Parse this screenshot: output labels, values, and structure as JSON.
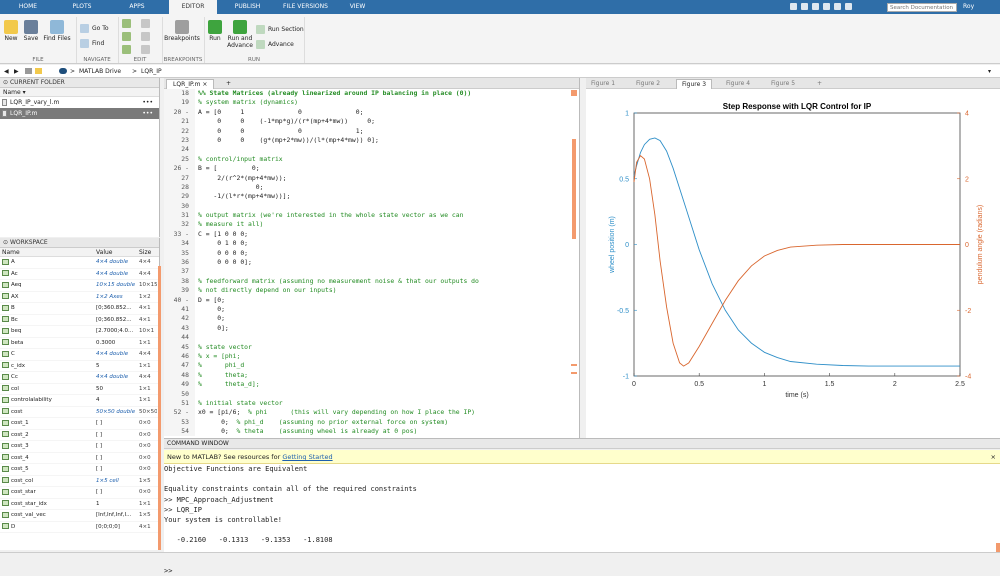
{
  "tabstrip": {
    "tabs": [
      "HOME",
      "PLOTS",
      "APPS",
      "EDITOR",
      "PUBLISH",
      "FILE VERSIONS",
      "VIEW"
    ],
    "active": "EDITOR",
    "search_placeholder": "Search Documentation",
    "user": "Roy"
  },
  "ribbon": {
    "file": {
      "new": "New",
      "save": "Save",
      "find_files": "Find Files",
      "group": "FILE"
    },
    "navigate": {
      "goto": "Go To",
      "find": "Find",
      "group": "NAVIGATE"
    },
    "edit": {
      "group": "EDIT"
    },
    "breakpoints": {
      "label": "Breakpoints",
      "group": "BREAKPOINTS"
    },
    "run": {
      "run": "Run",
      "run_advance": "Run and",
      "run_advance2": "Advance",
      "run_section": "Run Section",
      "advance": "Advance",
      "group": "RUN"
    }
  },
  "address": {
    "sep": ">",
    "path": [
      "MATLAB Drive",
      "LQR_IP"
    ]
  },
  "current_folder": {
    "title": "CURRENT FOLDER",
    "col": "Name",
    "files": [
      {
        "name": "LQR_IP_vary_l.m",
        "selected": false
      },
      {
        "name": "LQR_IP.m",
        "selected": true
      }
    ]
  },
  "workspace": {
    "title": "WORKSPACE",
    "cols": [
      "Name",
      "Value",
      "Size"
    ],
    "rows": [
      {
        "n": "A",
        "v": "4×4 double",
        "s": "4×4",
        "i": true
      },
      {
        "n": "Ac",
        "v": "4×4 double",
        "s": "4×4",
        "i": true
      },
      {
        "n": "Aeq",
        "v": "10×15 double",
        "s": "10×15",
        "i": true
      },
      {
        "n": "AX",
        "v": "1×2 Axes",
        "s": "1×2",
        "i": true
      },
      {
        "n": "B",
        "v": "[0;360.852...",
        "s": "4×1",
        "i": false
      },
      {
        "n": "Bc",
        "v": "[0;360.852...",
        "s": "4×1",
        "i": false
      },
      {
        "n": "beq",
        "v": "[2.7000;4.0...",
        "s": "10×1",
        "i": false
      },
      {
        "n": "beta",
        "v": "0.3000",
        "s": "1×1",
        "i": false
      },
      {
        "n": "C",
        "v": "4×4 double",
        "s": "4×4",
        "i": true
      },
      {
        "n": "c_idx",
        "v": "5",
        "s": "1×1",
        "i": false
      },
      {
        "n": "Cc",
        "v": "4×4 double",
        "s": "4×4",
        "i": true
      },
      {
        "n": "col",
        "v": "50",
        "s": "1×1",
        "i": false
      },
      {
        "n": "controlalability",
        "v": "4",
        "s": "1×1",
        "i": false
      },
      {
        "n": "cost",
        "v": "50×50 double",
        "s": "50×50",
        "i": true
      },
      {
        "n": "cost_1",
        "v": "[ ]",
        "s": "0×0",
        "i": false
      },
      {
        "n": "cost_2",
        "v": "[ ]",
        "s": "0×0",
        "i": false
      },
      {
        "n": "cost_3",
        "v": "[ ]",
        "s": "0×0",
        "i": false
      },
      {
        "n": "cost_4",
        "v": "[ ]",
        "s": "0×0",
        "i": false
      },
      {
        "n": "cost_5",
        "v": "[ ]",
        "s": "0×0",
        "i": false
      },
      {
        "n": "cost_col",
        "v": "1×5 cell",
        "s": "1×5",
        "i": true
      },
      {
        "n": "cost_star",
        "v": "[ ]",
        "s": "0×0",
        "i": false
      },
      {
        "n": "cost_star_idx",
        "v": "1",
        "s": "1×1",
        "i": false
      },
      {
        "n": "cost_val_vec",
        "v": "[Inf,Inf,Inf,I...",
        "s": "1×5",
        "i": false
      },
      {
        "n": "D",
        "v": "[0;0;0;0]",
        "s": "4×1",
        "i": false
      }
    ]
  },
  "editor": {
    "tab": "LQR_IP.m",
    "lines": [
      {
        "n": "18",
        "t": "%% State Matrices (already linearized around IP balancing in place (0))",
        "c": "cb"
      },
      {
        "n": "19",
        "t": "% system matrix (dynamics)",
        "c": "cm"
      },
      {
        "n": "20 -",
        "t": "A = [0     1              0              0;",
        "c": ""
      },
      {
        "n": "21",
        "t": "     0     0    (-1*mp*g)/(r*(mp+4*mw))     0;",
        "c": ""
      },
      {
        "n": "22",
        "t": "     0     0              0              1;",
        "c": ""
      },
      {
        "n": "23",
        "t": "     0     0    (g*(mp+2*mw))/(l*(mp+4*mw)) 0];",
        "c": ""
      },
      {
        "n": "24",
        "t": "",
        "c": ""
      },
      {
        "n": "25",
        "t": "% control/input matrix",
        "c": "cm"
      },
      {
        "n": "26 -",
        "t": "B = [         0;",
        "c": ""
      },
      {
        "n": "27",
        "t": "     2/(r^2*(mp+4*mw));",
        "c": ""
      },
      {
        "n": "28",
        "t": "               0;",
        "c": ""
      },
      {
        "n": "29",
        "t": "    -1/(l*r*(mp+4*mw))];",
        "c": ""
      },
      {
        "n": "30",
        "t": "",
        "c": ""
      },
      {
        "n": "31",
        "t": "% output matrix (we're interested in the whole state vector as we can",
        "c": "cm"
      },
      {
        "n": "32",
        "t": "% measure it all)",
        "c": "cm"
      },
      {
        "n": "33 -",
        "t": "C = [1 0 0 0;",
        "c": ""
      },
      {
        "n": "34",
        "t": "     0 1 0 0;",
        "c": ""
      },
      {
        "n": "35",
        "t": "     0 0 0 0;",
        "c": ""
      },
      {
        "n": "36",
        "t": "     0 0 0 0];",
        "c": ""
      },
      {
        "n": "37",
        "t": "",
        "c": ""
      },
      {
        "n": "38",
        "t": "% feedforward matrix (assuming no measurement noise & that our outputs do",
        "c": "cm"
      },
      {
        "n": "39",
        "t": "% not directly depend on our inputs)",
        "c": "cm"
      },
      {
        "n": "40 -",
        "t": "D = [0;",
        "c": ""
      },
      {
        "n": "41",
        "t": "     0;",
        "c": ""
      },
      {
        "n": "42",
        "t": "     0;",
        "c": ""
      },
      {
        "n": "43",
        "t": "     0];",
        "c": ""
      },
      {
        "n": "44",
        "t": "",
        "c": ""
      },
      {
        "n": "45",
        "t": "% state vector",
        "c": "cm"
      },
      {
        "n": "46",
        "t": "% x = [phi;",
        "c": "cm"
      },
      {
        "n": "47",
        "t": "%      phi_d",
        "c": "cm"
      },
      {
        "n": "48",
        "t": "%      theta;",
        "c": "cm"
      },
      {
        "n": "49",
        "t": "%      theta_d];",
        "c": "cm"
      },
      {
        "n": "50",
        "t": "",
        "c": ""
      },
      {
        "n": "51",
        "t": "% initial state vector",
        "c": "cm"
      },
      {
        "n": "52 -",
        "t": "x0 = [pi/6;  % phi      (this will vary depending on how I place the IP)",
        "c": "mix"
      },
      {
        "n": "53",
        "t": "      0;  % phi_d    (assuming no prior external force on system)",
        "c": "mix"
      },
      {
        "n": "54",
        "t": "      0;  % theta    (assuming wheel is already at 0 pos)",
        "c": "mix"
      }
    ]
  },
  "figures": {
    "tabs": [
      "Figure 1",
      "Figure 2",
      "Figure 3",
      "Figure 4",
      "Figure 5"
    ],
    "active": "Figure 3"
  },
  "chart_data": {
    "type": "line",
    "title": "Step Response with LQR Control for IP",
    "xlabel": "time (s)",
    "ylabel_left": "wheel position (m)",
    "ylabel_right": "pendulum angle (radians)",
    "xlim": [
      0,
      2.5
    ],
    "ylim_left": [
      -1,
      1
    ],
    "ylim_right": [
      -4,
      4
    ],
    "xticks": [
      "0",
      "0.5",
      "1",
      "1.5",
      "2",
      "2.5"
    ],
    "yticks_left": [
      "1",
      "0.5",
      "0",
      "-0.5",
      "-1"
    ],
    "yticks_right": [
      "4",
      "2",
      "0",
      "-2",
      "-4"
    ],
    "colors": {
      "left": "#2f8fc8",
      "right": "#d9662e"
    },
    "series": [
      {
        "axis": "left",
        "x": [
          0,
          0.02,
          0.05,
          0.08,
          0.12,
          0.16,
          0.2,
          0.25,
          0.3,
          0.4,
          0.5,
          0.6,
          0.7,
          0.8,
          0.9,
          1.0,
          1.1,
          1.2,
          1.4,
          1.6,
          1.8,
          2.0,
          2.2,
          2.5
        ],
        "y": [
          0.52,
          0.6,
          0.7,
          0.76,
          0.8,
          0.81,
          0.79,
          0.71,
          0.58,
          0.27,
          -0.04,
          -0.3,
          -0.5,
          -0.65,
          -0.75,
          -0.82,
          -0.86,
          -0.89,
          -0.91,
          -0.92,
          -0.925,
          -0.925,
          -0.925,
          -0.925
        ]
      },
      {
        "axis": "right",
        "x": [
          0,
          0.02,
          0.05,
          0.08,
          0.12,
          0.16,
          0.2,
          0.25,
          0.3,
          0.35,
          0.38,
          0.42,
          0.5,
          0.6,
          0.7,
          0.8,
          0.9,
          1.0,
          1.1,
          1.2,
          1.4,
          1.6,
          2.0,
          2.5
        ],
        "y": [
          1.9,
          2.5,
          2.7,
          2.6,
          2.0,
          0.9,
          -0.5,
          -1.9,
          -3.0,
          -3.6,
          -3.7,
          -3.6,
          -3.1,
          -2.4,
          -1.7,
          -1.1,
          -0.65,
          -0.35,
          -0.18,
          -0.08,
          -0.02,
          0,
          0,
          0
        ]
      }
    ]
  },
  "command_window": {
    "title": "COMMAND WINDOW",
    "banner_text": "New to MATLAB? See resources for ",
    "banner_link": "Getting Started",
    "lines": [
      "Objective Functions are Equivalent",
      "",
      "Equality constraints contain all of the required constraints",
      ">> MPC_Approach_Adjustment",
      ">> LQR_IP",
      "Your system is controllable!",
      "",
      "   -0.2160   -0.1313   -9.1353   -1.8108",
      "",
      ""
    ],
    "prompt": ">>"
  }
}
